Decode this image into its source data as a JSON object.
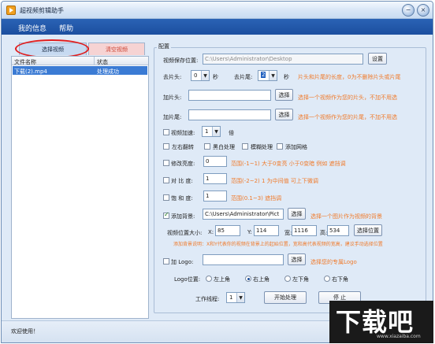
{
  "window": {
    "title": "超视频剪辑助手",
    "min": "−",
    "close": "×"
  },
  "menu": {
    "items": [
      "我的信息",
      "帮助"
    ]
  },
  "tabs": {
    "select_video": "选择视频",
    "clear_video": "清空视频"
  },
  "file_list": {
    "col_name": "文件名称",
    "col_status": "状态",
    "rows": [
      {
        "name": "下载(2).mp4",
        "status": "处理成功"
      }
    ]
  },
  "config": {
    "group_title": "配置",
    "save_location": {
      "label": "视频保存位置:",
      "value": "C:\\Users\\Administrator\\Desktop",
      "button": "设置"
    },
    "trim": {
      "head_label": "去片头:",
      "head_value": "0",
      "head_unit": "秒",
      "tail_label": "去片尾:",
      "tail_value": "2",
      "tail_unit": "秒",
      "hint": "片头和片尾的长度，0为不删除片头或片尾"
    },
    "add_head": {
      "label": "加片头:",
      "value": "",
      "button": "选择",
      "hint": "选择一个视频作为您的片头，不加不用选"
    },
    "add_tail": {
      "label": "加片尾:",
      "value": "",
      "button": "选择",
      "hint": "选择一个视频作为您的片尾，不加不用选"
    },
    "speed": {
      "label": "视频加速:",
      "value": "1",
      "unit": "倍"
    },
    "effects": [
      "左右翻转",
      "黑白处理",
      "模糊处理",
      "添加网格"
    ],
    "brightness": {
      "label": "修改亮度:",
      "value": "0",
      "hint": "范围(-1~1)  大于0变亮 小于0变暗 例如 遮挡调"
    },
    "contrast": {
      "label": "对  比  度:",
      "value": "1",
      "hint": "范围(-2~2)  1 为中间值  可上下微调"
    },
    "saturation": {
      "label": "饱  和  度:",
      "value": "1",
      "hint": "范围(0.1~3)  遮挡调"
    },
    "background": {
      "label": "添加背景:",
      "value": "C:\\Users\\Administrator\\Pict",
      "button": "选择",
      "hint": "选择一个图片作为视频的背景",
      "pos_label": "视频位置大小:",
      "x_label": "X:",
      "x": "85",
      "y_label": "Y:",
      "y": "114",
      "w_label": "宽:",
      "w": "1116",
      "h_label": "高:",
      "h": "534",
      "pos_button": "选择位置",
      "note": "添加背景说明：X和Y代表你的视频在背景上的起始位置，宽和高代表视频的宽高，建议手动选择位置"
    },
    "logo": {
      "label": "加 Logo:",
      "value": "",
      "button": "选择",
      "hint": "选择您的专属Logo"
    },
    "logo_position": {
      "label": "Logo位置:",
      "options": [
        "左上角",
        "右上角",
        "左下角",
        "右下角"
      ],
      "selected": "右上角"
    },
    "threads": {
      "label": "工作线程:",
      "value": "1"
    },
    "start_button": "开始处理",
    "stop_button": "停  止"
  },
  "status": {
    "text": "欢迎使用！"
  },
  "watermark": {
    "big": "下载吧",
    "small": "www.xiazaiba.com"
  }
}
